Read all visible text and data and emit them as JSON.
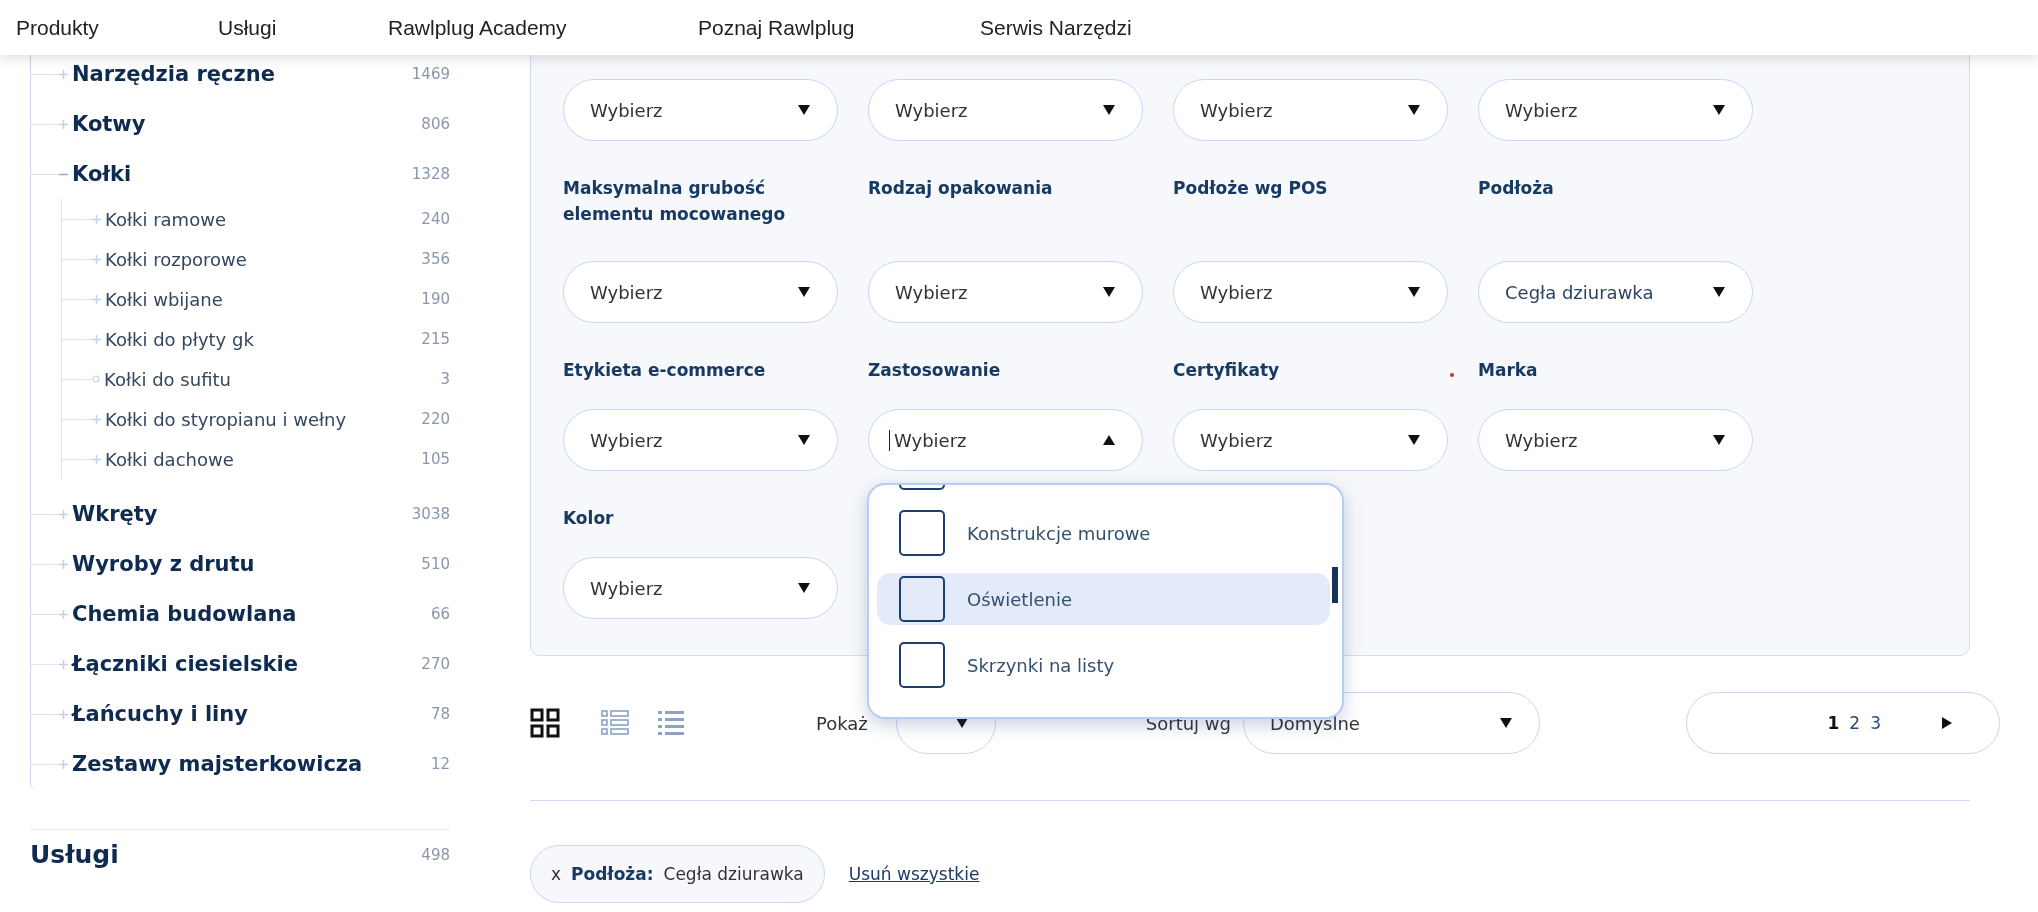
{
  "nav": [
    {
      "label": "Produkty"
    },
    {
      "label": "Usługi"
    },
    {
      "label": "Rawlplug Academy"
    },
    {
      "label": "Poznaj Rawlplug"
    },
    {
      "label": "Serwis Narzędzi"
    }
  ],
  "sidebar": {
    "categories": [
      {
        "label": "Narzędzia ręczne",
        "count": "1469",
        "expanded": false
      },
      {
        "label": "Kotwy",
        "count": "806",
        "expanded": false
      },
      {
        "label": "Kołki",
        "count": "1328",
        "expanded": true,
        "children": [
          {
            "label": "Kołki ramowe",
            "count": "240",
            "kind": "branch"
          },
          {
            "label": "Kołki rozporowe",
            "count": "356",
            "kind": "branch"
          },
          {
            "label": "Kołki wbijane",
            "count": "190",
            "kind": "branch"
          },
          {
            "label": "Kołki do płyty gk",
            "count": "215",
            "kind": "branch"
          },
          {
            "label": "Kołki do sufitu",
            "count": "3",
            "kind": "leaf"
          },
          {
            "label": "Kołki do styropianu i wełny",
            "count": "220",
            "kind": "branch"
          },
          {
            "label": "Kołki dachowe",
            "count": "105",
            "kind": "branch"
          }
        ]
      },
      {
        "label": "Wkręty",
        "count": "3038",
        "expanded": false
      },
      {
        "label": "Wyroby z drutu",
        "count": "510",
        "expanded": false
      },
      {
        "label": "Chemia budowlana",
        "count": "66",
        "expanded": false
      },
      {
        "label": "Łączniki ciesielskie",
        "count": "270",
        "expanded": false
      },
      {
        "label": "Łańcuchy i liny",
        "count": "78",
        "expanded": false
      },
      {
        "label": "Zestawy majsterkowicza",
        "count": "12",
        "expanded": false
      }
    ],
    "section": {
      "label": "Usługi",
      "count": "498"
    }
  },
  "filters": [
    {
      "value": "Wybierz",
      "open": false
    },
    {
      "value": "Wybierz",
      "open": false
    },
    {
      "value": "Wybierz",
      "open": false
    },
    {
      "value": "Wybierz",
      "open": false
    },
    {
      "label": "Maksymalna grubość elementu mocowanego",
      "value": "Wybierz",
      "open": false
    },
    {
      "label": "Rodzaj opakowania",
      "value": "Wybierz",
      "open": false
    },
    {
      "label": "Podłoże wg POS",
      "value": "Wybierz",
      "open": false
    },
    {
      "label": "Podłoża",
      "value": "Cegła dziurawka",
      "open": false
    },
    {
      "label": "Etykieta e-commerce",
      "value": "Wybierz",
      "open": false
    },
    {
      "label": "Zastosowanie",
      "value": "Wybierz",
      "open": true,
      "options": [
        {
          "checked": false,
          "selected": false
        },
        {
          "label": "Konstrukcje murowe",
          "checked": false,
          "selected": false
        },
        {
          "label": "Oświetlenie",
          "checked": false,
          "selected": true
        },
        {
          "label": "Skrzynki na listy",
          "checked": false,
          "selected": false
        }
      ]
    },
    {
      "label": "Certyfikaty",
      "value": "Wybierz",
      "open": false
    },
    {
      "label": "Marka",
      "value": "Wybierz",
      "open": false
    },
    {
      "label": "Kolor",
      "value": "Wybierz",
      "open": false
    }
  ],
  "toolbar": {
    "views": [
      {
        "kind": "grid",
        "selected": true
      },
      {
        "kind": "cards",
        "selected": false
      },
      {
        "kind": "list",
        "selected": false
      }
    ],
    "show_label": "Pokaż",
    "sort_label": "Sortuj wg",
    "sort": "Domyślne",
    "pages": [
      {
        "label": "1",
        "selected": true
      },
      {
        "label": "2",
        "selected": false
      },
      {
        "label": "3",
        "selected": false
      }
    ]
  },
  "active_filters": [
    {
      "name": "Podłoża:",
      "value": "Cegła dziurawka",
      "remove": "x"
    }
  ],
  "clear_all": "Usuń wszystkie"
}
